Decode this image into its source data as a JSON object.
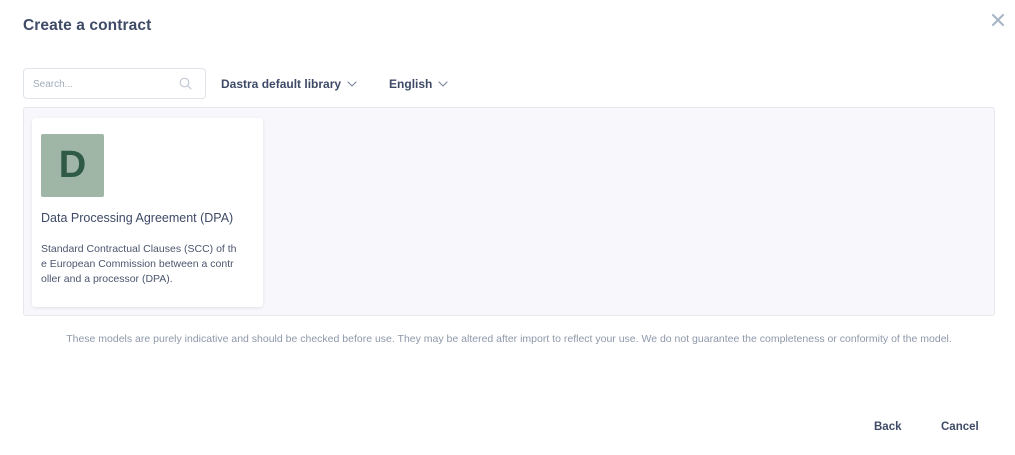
{
  "dialog": {
    "title": "Create a contract"
  },
  "toolbar": {
    "search_placeholder": "Search...",
    "search_value": "",
    "library_label": "Dastra default library",
    "language_label": "English"
  },
  "templates": [
    {
      "thumbnail_letter": "D",
      "thumbnail_color": "#9fb6a6",
      "title": "Data Processing Agreement (DPA)",
      "description": "Standard Contractual Clauses (SCC) of the European Commission between a controller and a processor (DPA)."
    }
  ],
  "disclaimer": "These models are purely indicative and should be checked before use. They may be altered after import to reflect your use. We do not guarantee the completeness or conformity of the model.",
  "footer": {
    "back_label": "Back",
    "cancel_label": "Cancel"
  },
  "colors": {
    "accent": "#3e4a66",
    "muted_text": "#8e98aa",
    "panel_bg": "#f8f8fc",
    "close_icon": "#a9b6c8"
  }
}
